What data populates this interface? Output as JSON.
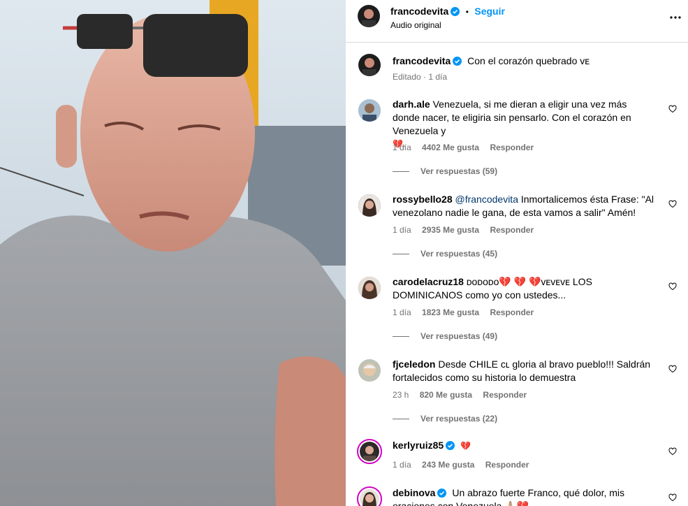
{
  "header": {
    "username": "francodevita",
    "separator": "•",
    "follow_label": "Seguir",
    "subtitle": "Audio original"
  },
  "caption": {
    "username": "francodevita",
    "text": "Con el corazón quebrado ᴠᴇ",
    "edited": "Editado · 1 día"
  },
  "comments": [
    {
      "username": "darh.ale",
      "text": "Venezuela, si me dieran a eligir una vez más donde nacer, te eligiria sin pensarlo. Con el corazón en Venezuela y",
      "text2": "💔.",
      "time": "1 día",
      "likes": "4402 Me gusta",
      "reply": "Responder",
      "view_replies": "Ver respuestas (59)"
    },
    {
      "username": "rossybello28",
      "mention": "@francodevita",
      "text": "Inmortalicemos ésta Frase: \"Al venezolano nadie le gana, de esta vamos a salir\" Amén!",
      "time": "1 día",
      "likes": "2935 Me gusta",
      "reply": "Responder",
      "view_replies": "Ver respuestas (45)"
    },
    {
      "username": "carodelacruz18",
      "text": "ᴅᴏᴅᴏᴅᴏ💔 💔 💔ᴠᴇᴠᴇᴠᴇ LOS DOMINICANOS como yo con ustedes...",
      "time": "1 día",
      "likes": "1823 Me gusta",
      "reply": "Responder",
      "view_replies": "Ver respuestas (49)"
    },
    {
      "username": "fjceledon",
      "text": "Desde CHILE ᴄʟ gloria al bravo pueblo!!! Saldrán fortalecidos como su historia lo demuestra",
      "time": "23 h",
      "likes": "820 Me gusta",
      "reply": "Responder",
      "view_replies": "Ver respuestas (22)"
    },
    {
      "username": "kerlyruiz85",
      "text": "💔",
      "time": "1 día",
      "likes": "243 Me gusta",
      "reply": "Responder"
    },
    {
      "username": "debinova",
      "text": "Un abrazo fuerte Franco, qué dolor, mis oraciones con Venezuela 🙏🏼💔"
    }
  ],
  "icons": {
    "verified": "verified-badge-icon",
    "more": "more-options-icon",
    "like": "heart-outline-icon"
  },
  "colors": {
    "accent": "#0095f6",
    "verified": "#0095f6",
    "meta": "#737373",
    "mention": "#00376b",
    "story_ring": "#d300c5"
  }
}
